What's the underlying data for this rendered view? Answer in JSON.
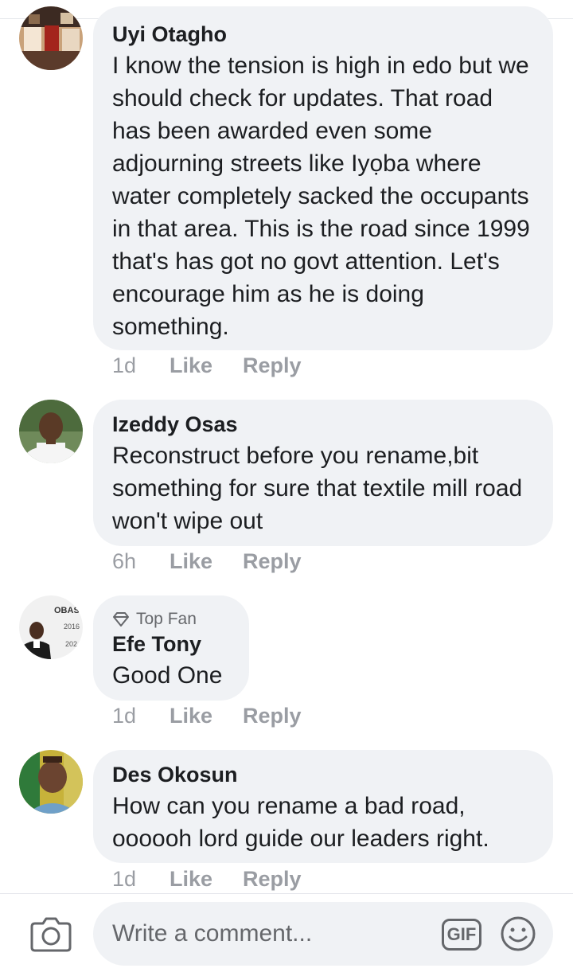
{
  "comments": [
    {
      "author": "Uyi Otagho",
      "text": "I know the tension is high in edo but we should check for updates. That road has been awarded even some adjourning streets like Iyọba where water completely sacked the occupants in that area. This is the road since 1999 that's has got no govt attention. Let's encourage him as he is doing something.",
      "time": "1d",
      "like": "Like",
      "reply": "Reply"
    },
    {
      "author": "Izeddy Osas",
      "text": "Reconstruct before you rename,bit something for sure that textile mill road won't wipe out",
      "time": "6h",
      "like": "Like",
      "reply": "Reply"
    },
    {
      "badge": "Top Fan",
      "author": "Efe Tony",
      "text": "Good One",
      "time": "1d",
      "like": "Like",
      "reply": "Reply",
      "avatar_text": [
        "OBASEK",
        "2016",
        "202"
      ]
    },
    {
      "author": "Des Okosun",
      "text": "How can you rename a bad road, oooooh lord guide our leaders right.",
      "time": "1d",
      "like": "Like",
      "reply": "Reply"
    }
  ],
  "composer": {
    "placeholder": "Write a comment...",
    "gif_label": "GIF",
    "icons": [
      "camera-icon",
      "gif-icon",
      "emoji-icon"
    ]
  },
  "colors": {
    "bubble": "#f0f2f5",
    "meta": "#9a9da3",
    "text": "#1c1e21"
  }
}
